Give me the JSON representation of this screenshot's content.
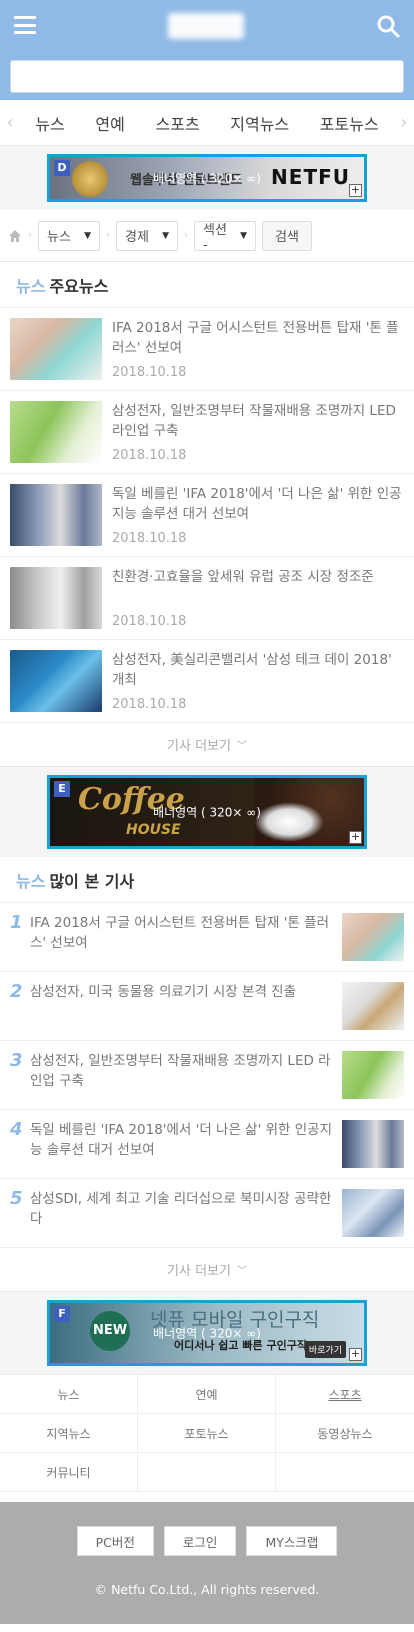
{
  "header": {
    "search_placeholder": ""
  },
  "nav": {
    "tabs": [
      "뉴스",
      "연예",
      "스포츠",
      "지역뉴스",
      "포토뉴스"
    ]
  },
  "banners": {
    "d": {
      "badge": "D",
      "label": "배너영역 ( 320× ∞)",
      "text": "웹솔루션 전문브랜드",
      "logo": "NETFU"
    },
    "e": {
      "badge": "E",
      "label": "배너영역 ( 320× ∞)",
      "coffee": "Coffee",
      "house": "HOUSE"
    },
    "f": {
      "badge": "F",
      "label": "배너영역 ( 320× ∞)",
      "new": "NEW",
      "big": "넷퓨 모바일 구인구직",
      "sub": "어디서나 쉽고 빠른 구인구직!",
      "goto": "바로가기"
    }
  },
  "filter": {
    "select1": "뉴스",
    "select2": "경제",
    "select3": "섹션 -",
    "search_button": "검색"
  },
  "main_news": {
    "category": "뉴스",
    "title": "주요뉴스",
    "items": [
      {
        "title": "IFA 2018서 구글 어시스턴트 전용버튼 탑재 '톤 플러스' 선보여",
        "date": "2018.10.18"
      },
      {
        "title": "삼성전자, 일반조명부터 작물재배용 조명까지 LED 라인업 구축",
        "date": "2018.10.18"
      },
      {
        "title": "독일 베를린 'IFA 2018'에서 '더 나은 삶' 위한 인공지능 솔루션 대거 선보여",
        "date": "2018.10.18"
      },
      {
        "title": "친환경·고효율을 앞세워 유럽 공조 시장 정조준",
        "date": "2018.10.18"
      },
      {
        "title": "삼성전자, 美실리콘밸리서 '삼성 테크 데이 2018' 개최",
        "date": "2018.10.18"
      }
    ],
    "more": "기사 더보기"
  },
  "popular": {
    "category": "뉴스",
    "title": "많이 본 기사",
    "items": [
      {
        "rank": "1",
        "title": "IFA 2018서 구글 어시스턴트 전용버튼 탑재 '톤 플러스' 선보여"
      },
      {
        "rank": "2",
        "title": "삼성전자, 미국 동물용 의료기기 시장 본격 진출"
      },
      {
        "rank": "3",
        "title": "삼성전자, 일반조명부터 작물재배용 조명까지 LED 라인업 구축"
      },
      {
        "rank": "4",
        "title": "독일 베를린 'IFA 2018'에서 '더 나은 삶' 위한 인공지능 솔루션 대거 선보여"
      },
      {
        "rank": "5",
        "title": "삼성SDI, 세계 최고 기술 리더십으로 북미시장 공략한다"
      }
    ],
    "more": "기사 더보기"
  },
  "categories": [
    "뉴스",
    "연예",
    "스포츠",
    "지역뉴스",
    "포토뉴스",
    "동영상뉴스",
    "커뮤니티"
  ],
  "footer": {
    "pc": "PC버전",
    "login": "로그인",
    "scrap": "MY스크랩",
    "copyright": "© Netfu Co.Ltd., All rights reserved."
  },
  "colors": {
    "header_bg": "#8fb9e6",
    "accent": "#8fb9e6",
    "banner_border": "#1a9fd7",
    "footer_bg": "#acacac"
  }
}
